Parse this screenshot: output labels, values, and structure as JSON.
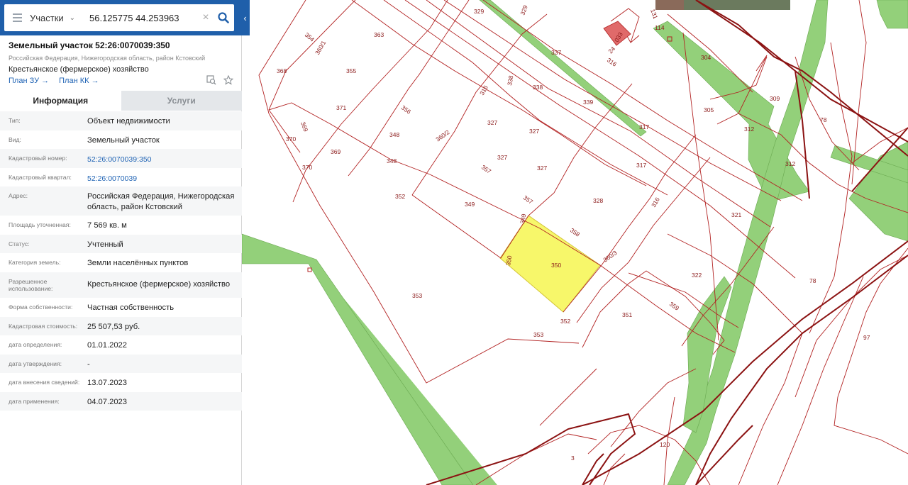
{
  "search": {
    "layer": "Участки",
    "query": "56.125775 44.253963"
  },
  "card": {
    "title": "Земельный участок 52:26:0070039:350",
    "address": "Российская Федерация, Нижегородская область, район Кстовский",
    "use": "Крестьянское (фермерское) хозяйство",
    "link_zu": "План ЗУ →",
    "link_kk": "План КК →"
  },
  "tabs": {
    "info": "Информация",
    "services": "Услуги"
  },
  "rows": [
    {
      "label": "Тип:",
      "value": "Объект недвижимости"
    },
    {
      "label": "Вид:",
      "value": "Земельный участок"
    },
    {
      "label": "Кадастровый номер:",
      "value": "52:26:0070039:350"
    },
    {
      "label": "Кадастровый квартал:",
      "value": "52:26:0070039"
    },
    {
      "label": "Адрес:",
      "value": "Российская Федерация, Нижегородская область, район Кстовский"
    },
    {
      "label": "Площадь уточненная:",
      "value": "7 569 кв. м"
    },
    {
      "label": "Статус:",
      "value": "Учтенный"
    },
    {
      "label": "Категория земель:",
      "value": "Земли населённых пунктов"
    },
    {
      "label": "Разрешенное использование:",
      "value": "Крестьянское (фермерское) хозяйство"
    },
    {
      "label": "Форма собственности:",
      "value": "Частная собственность"
    },
    {
      "label": "Кадастровая стоимость:",
      "value": "25 507,53 руб."
    },
    {
      "label": "дата определения:",
      "value": "01.01.2022"
    },
    {
      "label": "дата утверждения:",
      "value": "-"
    },
    {
      "label": "дата внесения сведений:",
      "value": "13.07.2023"
    },
    {
      "label": "дата применения:",
      "value": "04.07.2023"
    }
  ],
  "map_labels": [
    "329",
    "329",
    "363",
    "354",
    "360/1",
    "368",
    "355",
    "337",
    "338",
    "338",
    "316",
    "316",
    "339",
    "371",
    "356",
    "327",
    "327",
    "369",
    "370",
    "348",
    "348",
    "360/2",
    "327",
    "327",
    "370",
    "369",
    "357",
    "352",
    "349",
    "357",
    "349",
    "328",
    "358",
    "350",
    "350",
    "360/3",
    "353",
    "352",
    "351",
    "353",
    "359",
    "317",
    "317",
    "316",
    "114",
    "033",
    "24",
    "131",
    "304",
    "305",
    "309",
    "312",
    "312",
    "78",
    "321",
    "322",
    "78",
    "97",
    "120",
    "3"
  ],
  "colors": {
    "accent": "#1f5faa",
    "parcel_line": "#b22222",
    "selected_fill": "#f7f76a",
    "road_fill": "#93d07a"
  }
}
